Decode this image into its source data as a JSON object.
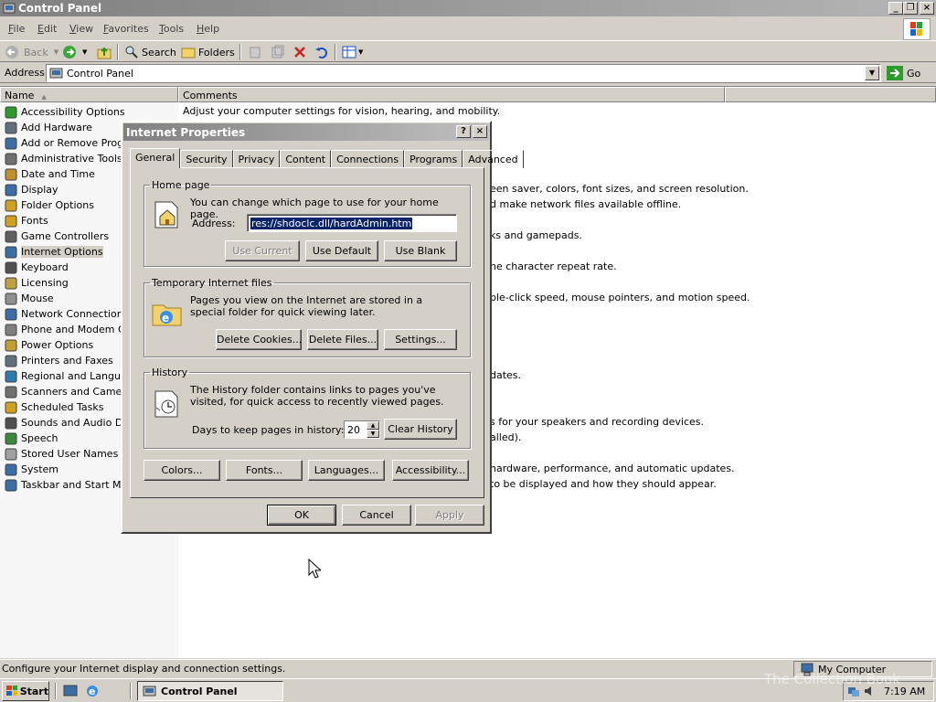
{
  "window": {
    "title": "Control Panel",
    "caption_buttons": [
      "_",
      "❐",
      "×"
    ]
  },
  "menu": [
    "File",
    "Edit",
    "View",
    "Favorites",
    "Tools",
    "Help"
  ],
  "toolbar": {
    "back": "Back",
    "search": "Search",
    "folders": "Folders"
  },
  "address": {
    "label": "Address",
    "value": "Control Panel",
    "go": "Go"
  },
  "columns": {
    "name": "Name",
    "comments": "Comments"
  },
  "items": [
    "Accessibility Options",
    "Add Hardware",
    "Add or Remove Progra",
    "Administrative Tools",
    "Date and Time",
    "Display",
    "Folder Options",
    "Fonts",
    "Game Controllers",
    "Internet Options",
    "Keyboard",
    "Licensing",
    "Mouse",
    "Network Connections",
    "Phone and Modem Opt",
    "Power Options",
    "Printers and Faxes",
    "Regional and Language",
    "Scanners and Cameras",
    "Scheduled Tasks",
    "Sounds and Audio Dev",
    "Speech",
    "Stored User Names and",
    "System",
    "Taskbar and Start Men"
  ],
  "comments": {
    "c0": "Adjust your computer settings for vision, hearing, and mobility.",
    "c5": "een saver, colors, font sizes, and screen resolution.",
    "c6": "d make network files available offline.",
    "c8": "ks and gamepads.",
    "c10": "he character repeat rate.",
    "c12": "ble-click speed, mouse pointers, and motion speed.",
    "c17": "dates.",
    "c20": "s for your speakers and recording devices.",
    "c21": "alled).",
    "c23": "hardware, performance, and automatic updates.",
    "c24": "to be displayed and how they should appear."
  },
  "status": {
    "text": "Configure your Internet display and connection settings.",
    "zone": "My Computer"
  },
  "taskbar": {
    "start": "Start",
    "task": "Control Panel",
    "clock": "7:19 AM",
    "watermark": "The Collection Book"
  },
  "dialog": {
    "title": "Internet Properties",
    "help_btn": "?",
    "close_btn": "×",
    "tabs": [
      "General",
      "Security",
      "Privacy",
      "Content",
      "Connections",
      "Programs",
      "Advanced"
    ],
    "home": {
      "legend": "Home page",
      "text": "You can change which page to use for your home page.",
      "address_label": "Address:",
      "address_value": "res://shdoclc.dll/hardAdmin.htm",
      "use_current": "Use Current",
      "use_default": "Use Default",
      "use_blank": "Use Blank"
    },
    "temp": {
      "legend": "Temporary Internet files",
      "text": "Pages you view on the Internet are stored in a special folder for quick viewing later.",
      "delete_cookies": "Delete Cookies...",
      "delete_files": "Delete Files...",
      "settings": "Settings..."
    },
    "history": {
      "legend": "History",
      "text": "The History folder contains links to pages you've visited, for quick access to recently viewed pages.",
      "days_label": "Days to keep pages in history:",
      "days_value": "20",
      "clear": "Clear History"
    },
    "bottom": {
      "colors": "Colors...",
      "fonts": "Fonts...",
      "languages": "Languages...",
      "accessibility": "Accessibility..."
    },
    "ok": "OK",
    "cancel": "Cancel",
    "apply": "Apply"
  }
}
